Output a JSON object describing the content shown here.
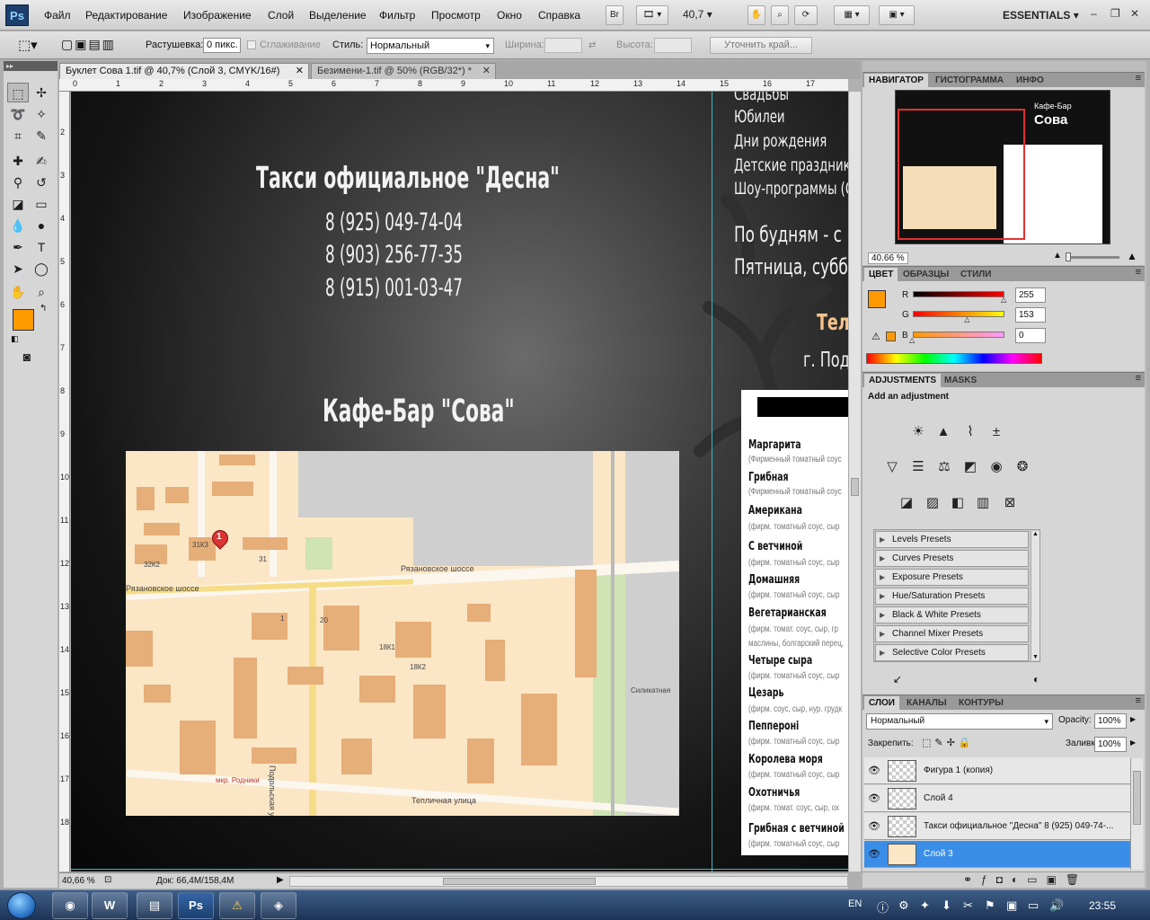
{
  "app": {
    "logo": "Ps",
    "menu": [
      "Файл",
      "Редактирование",
      "Изображение",
      "Слой",
      "Выделение",
      "Фильтр",
      "Просмотр",
      "Окно",
      "Справка"
    ],
    "bridge_label": "Br",
    "zoom": "40,7",
    "workspace": "ESSENTIALS"
  },
  "options": {
    "feather_label": "Растушевка:",
    "feather_value": "0 пикс.",
    "antialias_label": "Сглаживание",
    "style_label": "Стиль:",
    "style_value": "Нормальный",
    "width_label": "Ширина:",
    "height_label": "Высота:",
    "refine_label": "Уточнить край..."
  },
  "tabs": [
    {
      "label": "Буклет Сова 1.tif @ 40,7% (Слой 3, CMYK/16#)",
      "active": true
    },
    {
      "label": "Безимени-1.tif @ 50% (RGB/32*) *",
      "active": false
    }
  ],
  "ruler": {
    "top": [
      "0",
      "1",
      "2",
      "3",
      "4",
      "5",
      "6",
      "7",
      "8",
      "9",
      "10",
      "11",
      "12",
      "13",
      "14",
      "15",
      "16",
      "17"
    ],
    "left": [
      "2",
      "3",
      "4",
      "5",
      "6",
      "7",
      "8",
      "9",
      "10",
      "11",
      "12",
      "13",
      "14",
      "15",
      "16",
      "17",
      "18"
    ]
  },
  "canvas": {
    "taxi_title": "Такси официальное \"Десна\"",
    "taxi_phones": [
      "8 (925) 049-74-04",
      "8 (903) 256-77-35",
      "8 (915) 001-03-47"
    ],
    "cafe_title": "Кафе-Бар \"Сова\"",
    "events": [
      "Свадьбы",
      "Юбилеи",
      "Дни рождения",
      "Детские праздники",
      "Шоу-программы (Ст"
    ],
    "hours": [
      "По будням - с",
      "Пятница, субб"
    ],
    "tel_label": "Тел.",
    "city_label": "г. Подо",
    "map": {
      "marker": "1",
      "labels": [
        "31К3",
        "32К2",
        "31",
        "Рязановское шоссе",
        "Рязановское шоссе",
        "20",
        "18К1",
        "18К2",
        "Подольская улица",
        "Силикатная",
        "мкр. Родники",
        "Тепличная улица",
        "1"
      ]
    },
    "menu_items": [
      {
        "name": "Маргарита",
        "desc": "(Фирменный томатный соус"
      },
      {
        "name": "Грибная",
        "desc": "(Фирменный томатный соус"
      },
      {
        "name": "Американа",
        "desc": "(фирм. томатный соус, сыр"
      },
      {
        "name": "С ветчиной",
        "desc": "(фирм. томатный соус, сыр"
      },
      {
        "name": "Домашняя",
        "desc": "(фирм. томатный соус, сыр"
      },
      {
        "name": "Вегетарианская",
        "desc": "(фирм. томат. соус, сыр, гр"
      },
      {
        "name": "",
        "desc": "маслины, болгарский перец,"
      },
      {
        "name": "Четыре сыра",
        "desc": "(фирм. томатный соус, сыр"
      },
      {
        "name": "Цезарь",
        "desc": "(фирм. соус, сыр, нур. грудк"
      },
      {
        "name": "Пеппероні",
        "desc": "(фирм. томатный соус, сыр"
      },
      {
        "name": "Королева моря",
        "desc": "(фирм. томатный соус, сыр"
      },
      {
        "name": "Охотничья",
        "desc": "(фирм. томат. соус, сыр, ох"
      },
      {
        "name": "Грибная с ветчиной",
        "desc": "(фирм. томатный соус, сыр"
      }
    ]
  },
  "status": {
    "zoom": "40,66 %",
    "doc": "Док: 66,4M/158,4M"
  },
  "navigator": {
    "tabs": [
      "НАВИГАТОР",
      "ГИСТОГРАММА",
      "ИНФО"
    ],
    "zoom": "40.66 %",
    "thumb_title_1": "Кафе-Бар",
    "thumb_title_2": "Сова"
  },
  "color": {
    "tabs": [
      "ЦВЕТ",
      "ОБРАЗЦЫ",
      "СТИЛИ"
    ],
    "r_label": "R",
    "g_label": "G",
    "b_label": "B",
    "r": 255,
    "g": 153,
    "b": 0,
    "foreground": "#ff9900",
    "background": "#000000"
  },
  "adjustments": {
    "tabs": [
      "ADJUSTMENTS",
      "MASKS"
    ],
    "heading": "Add an adjustment",
    "presets": [
      "Levels Presets",
      "Curves Presets",
      "Exposure Presets",
      "Hue/Saturation Presets",
      "Black & White Presets",
      "Channel Mixer Presets",
      "Selective Color Presets"
    ]
  },
  "layers": {
    "tabs": [
      "СЛОИ",
      "КАНАЛЫ",
      "КОНТУРЫ"
    ],
    "blend_mode": "Нормальный",
    "opacity_label": "Opacity:",
    "opacity": "100%",
    "lock_label": "Закрепить:",
    "fill_label": "Заливка:",
    "fill": "100%",
    "items": [
      {
        "name": "Фигура 1 (копия)",
        "selected": false
      },
      {
        "name": "Слой 4",
        "selected": false
      },
      {
        "name": "Такси официальное \"Десна\"  8 (925) 049-74-...",
        "selected": false
      },
      {
        "name": "Слой 3",
        "selected": true
      }
    ]
  },
  "taskbar": {
    "lang": "EN",
    "time": "23:55",
    "ps_label": "Ps"
  }
}
